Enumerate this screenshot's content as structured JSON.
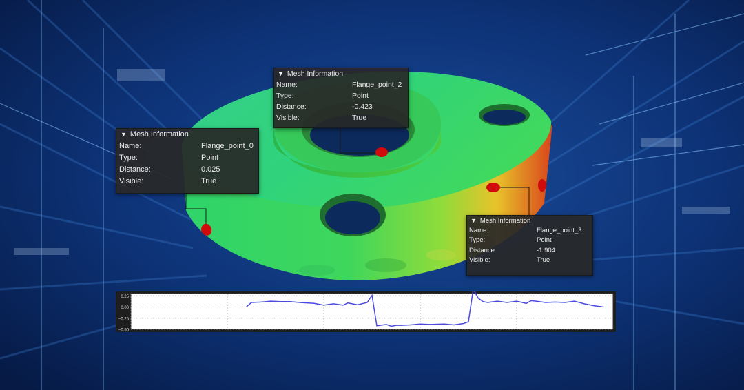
{
  "panels": [
    {
      "header": "Mesh Information",
      "rows": [
        {
          "key": "Name:",
          "value": "Flange_point_0"
        },
        {
          "key": "Type:",
          "value": "Point"
        },
        {
          "key": "Distance:",
          "value": "0.025"
        },
        {
          "key": "Visible:",
          "value": "True"
        }
      ]
    },
    {
      "header": "Mesh Information",
      "rows": [
        {
          "key": "Name:",
          "value": "Flange_point_2"
        },
        {
          "key": "Type:",
          "value": "Point"
        },
        {
          "key": "Distance:",
          "value": "-0.423"
        },
        {
          "key": "Visible:",
          "value": "True"
        }
      ]
    },
    {
      "header": "Mesh Information",
      "rows": [
        {
          "key": "Name:",
          "value": "Flange_point_3"
        },
        {
          "key": "Type:",
          "value": "Point"
        },
        {
          "key": "Distance:",
          "value": "-1.904"
        },
        {
          "key": "Visible:",
          "value": "True"
        }
      ]
    }
  ],
  "icons": {
    "collapse": "triangle-down-icon"
  },
  "colors": {
    "panel_bg": "#282828",
    "plot_line": "#4a4ae0",
    "marker": "#d00a0a",
    "background": "#0a2a63"
  },
  "chart_data": {
    "type": "line",
    "title": "",
    "xlabel": "",
    "ylabel": "",
    "yticks": [
      "0.25",
      "0.00",
      "−0.25",
      "−0.50"
    ],
    "ylim": [
      -0.5,
      0.3
    ],
    "xlim": [
      0,
      100
    ],
    "grid": true,
    "series": [
      {
        "x": [
          24,
          25,
          27,
          29,
          31,
          33,
          35,
          38,
          40,
          42,
          44,
          45,
          47,
          49,
          50,
          51,
          53,
          54,
          55,
          56,
          58,
          60,
          62,
          65,
          67,
          69,
          70,
          71,
          72,
          73,
          74,
          76,
          78,
          80,
          82,
          83,
          84,
          86,
          88,
          90,
          92,
          94,
          96,
          98
        ],
        "y": [
          0.01,
          0.1,
          0.11,
          0.13,
          0.12,
          0.12,
          0.1,
          0.08,
          0.04,
          0.07,
          0.04,
          0.09,
          0.05,
          0.1,
          0.26,
          -0.42,
          -0.39,
          -0.43,
          -0.41,
          -0.41,
          -0.4,
          -0.38,
          -0.39,
          -0.38,
          -0.4,
          -0.37,
          -0.33,
          0.4,
          0.2,
          0.12,
          0.1,
          0.13,
          0.1,
          0.13,
          0.08,
          0.14,
          0.13,
          0.1,
          0.11,
          0.1,
          0.13,
          0.07,
          0.03,
          0.0
        ]
      }
    ]
  }
}
